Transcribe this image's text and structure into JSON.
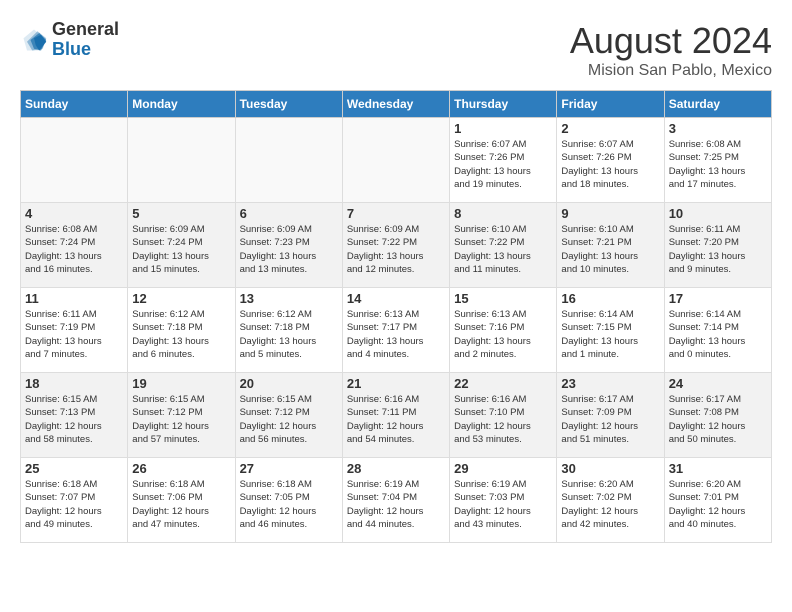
{
  "header": {
    "logo_general": "General",
    "logo_blue": "Blue",
    "main_title": "August 2024",
    "subtitle": "Mision San Pablo, Mexico"
  },
  "calendar": {
    "days_of_week": [
      "Sunday",
      "Monday",
      "Tuesday",
      "Wednesday",
      "Thursday",
      "Friday",
      "Saturday"
    ],
    "weeks": [
      [
        {
          "day": "",
          "info": ""
        },
        {
          "day": "",
          "info": ""
        },
        {
          "day": "",
          "info": ""
        },
        {
          "day": "",
          "info": ""
        },
        {
          "day": "1",
          "info": "Sunrise: 6:07 AM\nSunset: 7:26 PM\nDaylight: 13 hours\nand 19 minutes."
        },
        {
          "day": "2",
          "info": "Sunrise: 6:07 AM\nSunset: 7:26 PM\nDaylight: 13 hours\nand 18 minutes."
        },
        {
          "day": "3",
          "info": "Sunrise: 6:08 AM\nSunset: 7:25 PM\nDaylight: 13 hours\nand 17 minutes."
        }
      ],
      [
        {
          "day": "4",
          "info": "Sunrise: 6:08 AM\nSunset: 7:24 PM\nDaylight: 13 hours\nand 16 minutes."
        },
        {
          "day": "5",
          "info": "Sunrise: 6:09 AM\nSunset: 7:24 PM\nDaylight: 13 hours\nand 15 minutes."
        },
        {
          "day": "6",
          "info": "Sunrise: 6:09 AM\nSunset: 7:23 PM\nDaylight: 13 hours\nand 13 minutes."
        },
        {
          "day": "7",
          "info": "Sunrise: 6:09 AM\nSunset: 7:22 PM\nDaylight: 13 hours\nand 12 minutes."
        },
        {
          "day": "8",
          "info": "Sunrise: 6:10 AM\nSunset: 7:22 PM\nDaylight: 13 hours\nand 11 minutes."
        },
        {
          "day": "9",
          "info": "Sunrise: 6:10 AM\nSunset: 7:21 PM\nDaylight: 13 hours\nand 10 minutes."
        },
        {
          "day": "10",
          "info": "Sunrise: 6:11 AM\nSunset: 7:20 PM\nDaylight: 13 hours\nand 9 minutes."
        }
      ],
      [
        {
          "day": "11",
          "info": "Sunrise: 6:11 AM\nSunset: 7:19 PM\nDaylight: 13 hours\nand 7 minutes."
        },
        {
          "day": "12",
          "info": "Sunrise: 6:12 AM\nSunset: 7:18 PM\nDaylight: 13 hours\nand 6 minutes."
        },
        {
          "day": "13",
          "info": "Sunrise: 6:12 AM\nSunset: 7:18 PM\nDaylight: 13 hours\nand 5 minutes."
        },
        {
          "day": "14",
          "info": "Sunrise: 6:13 AM\nSunset: 7:17 PM\nDaylight: 13 hours\nand 4 minutes."
        },
        {
          "day": "15",
          "info": "Sunrise: 6:13 AM\nSunset: 7:16 PM\nDaylight: 13 hours\nand 2 minutes."
        },
        {
          "day": "16",
          "info": "Sunrise: 6:14 AM\nSunset: 7:15 PM\nDaylight: 13 hours\nand 1 minute."
        },
        {
          "day": "17",
          "info": "Sunrise: 6:14 AM\nSunset: 7:14 PM\nDaylight: 13 hours\nand 0 minutes."
        }
      ],
      [
        {
          "day": "18",
          "info": "Sunrise: 6:15 AM\nSunset: 7:13 PM\nDaylight: 12 hours\nand 58 minutes."
        },
        {
          "day": "19",
          "info": "Sunrise: 6:15 AM\nSunset: 7:12 PM\nDaylight: 12 hours\nand 57 minutes."
        },
        {
          "day": "20",
          "info": "Sunrise: 6:15 AM\nSunset: 7:12 PM\nDaylight: 12 hours\nand 56 minutes."
        },
        {
          "day": "21",
          "info": "Sunrise: 6:16 AM\nSunset: 7:11 PM\nDaylight: 12 hours\nand 54 minutes."
        },
        {
          "day": "22",
          "info": "Sunrise: 6:16 AM\nSunset: 7:10 PM\nDaylight: 12 hours\nand 53 minutes."
        },
        {
          "day": "23",
          "info": "Sunrise: 6:17 AM\nSunset: 7:09 PM\nDaylight: 12 hours\nand 51 minutes."
        },
        {
          "day": "24",
          "info": "Sunrise: 6:17 AM\nSunset: 7:08 PM\nDaylight: 12 hours\nand 50 minutes."
        }
      ],
      [
        {
          "day": "25",
          "info": "Sunrise: 6:18 AM\nSunset: 7:07 PM\nDaylight: 12 hours\nand 49 minutes."
        },
        {
          "day": "26",
          "info": "Sunrise: 6:18 AM\nSunset: 7:06 PM\nDaylight: 12 hours\nand 47 minutes."
        },
        {
          "day": "27",
          "info": "Sunrise: 6:18 AM\nSunset: 7:05 PM\nDaylight: 12 hours\nand 46 minutes."
        },
        {
          "day": "28",
          "info": "Sunrise: 6:19 AM\nSunset: 7:04 PM\nDaylight: 12 hours\nand 44 minutes."
        },
        {
          "day": "29",
          "info": "Sunrise: 6:19 AM\nSunset: 7:03 PM\nDaylight: 12 hours\nand 43 minutes."
        },
        {
          "day": "30",
          "info": "Sunrise: 6:20 AM\nSunset: 7:02 PM\nDaylight: 12 hours\nand 42 minutes."
        },
        {
          "day": "31",
          "info": "Sunrise: 6:20 AM\nSunset: 7:01 PM\nDaylight: 12 hours\nand 40 minutes."
        }
      ]
    ]
  }
}
